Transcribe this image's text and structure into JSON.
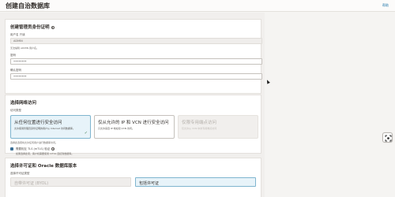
{
  "header": {
    "title": "创建自治数据库",
    "help": "帮助"
  },
  "admin_section": {
    "title": "创建管理员身份证明",
    "username_label": "用户名 只读",
    "username_value": "ADMIN",
    "username_hint": "无法编辑 ADMIN 用户名。",
    "password_label": "密码",
    "password_value": "••••••••",
    "confirm_label": "确认密码",
    "confirm_value": "••••••••"
  },
  "network_section": {
    "title": "选择网络访问",
    "access_type_label": "访问类型",
    "options": [
      {
        "title": "从任何位置进行安全访问",
        "desc": "允许使用管理员身份证明的用户从 Internet 访问数据库。",
        "state": "selected"
      },
      {
        "title": "仅从允许的 IP 和 VCN 进行安全访问",
        "desc": "只允许来自 IP 地址和 VCN 访问。",
        "state": "normal"
      },
      {
        "title": "仅限专用端点访问",
        "desc": "仅允许从 VCN 中的专用端点访问",
        "state": "disabled"
      }
    ],
    "options_hint": "选择此选项将允许任何用户进行数据库访问。",
    "mtls_label": "需要相互 TLS (mTLS) 验证",
    "mtls_hint": "如果选择此项，客户机需要使用 mTLS 连接到数据库。"
  },
  "license_section": {
    "title": "选择许可证和 Oracle 数据库版本",
    "license_type_label": "选择许可证类型",
    "options": [
      {
        "label": "自带许可证 (BYOL)",
        "state": "disabled"
      },
      {
        "label": "包括许可证",
        "state": "selected"
      }
    ]
  },
  "icons": {
    "info": "info-icon",
    "check": "check-icon",
    "float": "focus-frame-icon"
  }
}
